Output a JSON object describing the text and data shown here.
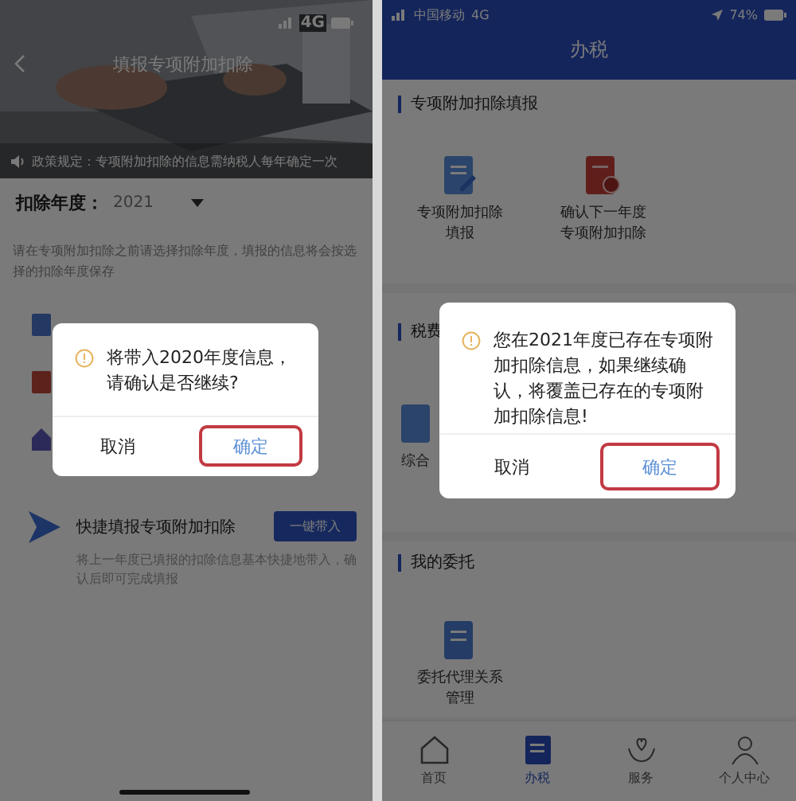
{
  "left_screen": {
    "status_bar": {
      "network": "4G"
    },
    "title": "填报专项附加扣除",
    "notice": "政策规定：专项附加扣除的信息需纳税人每年确定一次",
    "year": {
      "label": "扣除年度：",
      "value": "2021"
    },
    "description": "请在专项附加扣除之前请选择扣除年度，填报的信息将会按选择的扣除年度保存",
    "quick_fill": {
      "title": "快捷填报专项附加扣除",
      "button": "一键带入",
      "description": "将上一年度已填报的扣除信息基本快捷地带入，确认后即可完成填报"
    },
    "dialog": {
      "message": "将带入2020年度信息，请确认是否继续?",
      "buttons": [
        {
          "label": "取消",
          "annotated": false
        },
        {
          "label": "确定",
          "annotated": true
        }
      ]
    }
  },
  "right_screen": {
    "status_bar": {
      "carrier": "中国移动",
      "network": "4G",
      "battery": "74%"
    },
    "header": "办税",
    "sections": [
      {
        "title": "专项附加扣除填报",
        "items": [
          {
            "kind": "form",
            "label": "专项附加扣除填报"
          },
          {
            "kind": "confirm",
            "label": "确认下一年度专项附加扣除"
          }
        ]
      },
      {
        "title": "税费",
        "items": [
          {
            "kind": "summary",
            "label": "综合"
          }
        ]
      },
      {
        "title": "我的委托",
        "items": [
          {
            "kind": "delegate",
            "label": "委托代理关系管理"
          }
        ]
      }
    ],
    "dialog": {
      "message": "您在2021年度已存在专项附加扣除信息，如果继续确认，将覆盖已存在的专项附加扣除信息!",
      "buttons": [
        {
          "label": "取消",
          "annotated": false
        },
        {
          "label": "确定",
          "annotated": true
        }
      ]
    },
    "tabs": [
      {
        "label": "首页",
        "selected": false
      },
      {
        "label": "办税",
        "selected": true
      },
      {
        "label": "服务",
        "selected": false
      },
      {
        "label": "个人中心",
        "selected": false
      }
    ]
  }
}
